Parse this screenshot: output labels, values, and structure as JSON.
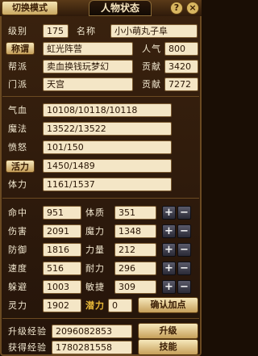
{
  "header": {
    "mode_button": "切换模式",
    "active_tab": "人物状态",
    "help": "?",
    "close": "×"
  },
  "profile": {
    "level_label": "级别",
    "level": "175",
    "name_label": "名称",
    "name": "小小萌丸子阜",
    "title_label": "称谓",
    "title": "虹光阵营",
    "popularity_label": "人气",
    "popularity": "800",
    "gang_label": "帮派",
    "gang": "卖血换钱玩梦幻",
    "contribution_label": "贡献",
    "contribution": "3420",
    "sect_label": "门派",
    "sect": "天宫",
    "sect_contribution_label": "贡献",
    "sect_contribution": "7272"
  },
  "vitals": {
    "hp_label": "气血",
    "hp": "10108/10118/10118",
    "mp_label": "魔法",
    "mp": "13522/13522",
    "rage_label": "愤怒",
    "rage": "101/150",
    "vitality_label": "活力",
    "vitality": "1450/1489",
    "stamina_label": "体力",
    "stamina": "1161/1537"
  },
  "stats": {
    "hit_label": "命中",
    "hit": "951",
    "con_label": "体质",
    "con": "351",
    "dmg_label": "伤害",
    "dmg": "2091",
    "mag_label": "魔力",
    "mag": "1348",
    "def_label": "防御",
    "def": "1816",
    "str_label": "力量",
    "str": "212",
    "spd_label": "速度",
    "spd": "516",
    "end_label": "耐力",
    "end": "296",
    "dodge_label": "躲避",
    "dodge": "1003",
    "agi_label": "敏捷",
    "agi": "309",
    "spirit_label": "灵力",
    "spirit": "1902",
    "potential_label": "潜力",
    "potential": "0",
    "confirm_button": "确认加点",
    "plus": "+",
    "minus": "−"
  },
  "experience": {
    "upgrade_label": "升级经验",
    "upgrade": "2096082853",
    "upgrade_button": "升级",
    "obtained_label": "获得经验",
    "obtained": "1780281558",
    "skill_button": "技能"
  }
}
